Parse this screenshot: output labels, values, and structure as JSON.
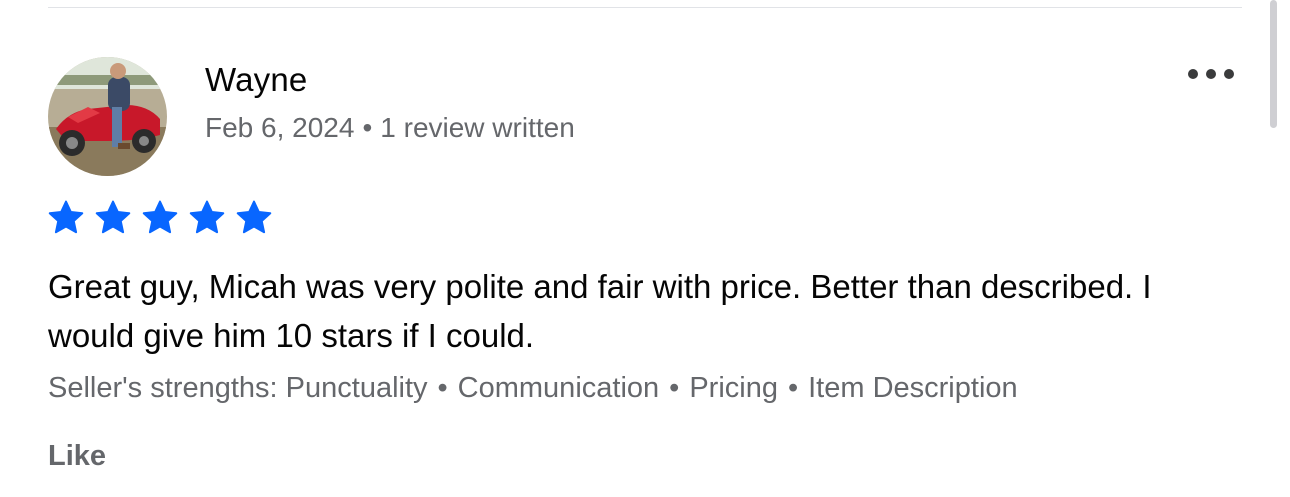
{
  "review": {
    "reviewer_name": "Wayne",
    "date": "Feb 6, 2024",
    "separator": "•",
    "reviews_written": "1 review written",
    "rating": 5,
    "rating_max": 5,
    "star_color": "#0866ff",
    "text": "Great guy, Micah was very polite and fair with price. Better than described. I would give him 10 stars if I could.",
    "strengths_label": "Seller's strengths:",
    "strengths": [
      "Punctuality",
      "Communication",
      "Pricing",
      "Item Description"
    ],
    "like_label": "Like",
    "more_icon": "more-horizontal-icon"
  }
}
